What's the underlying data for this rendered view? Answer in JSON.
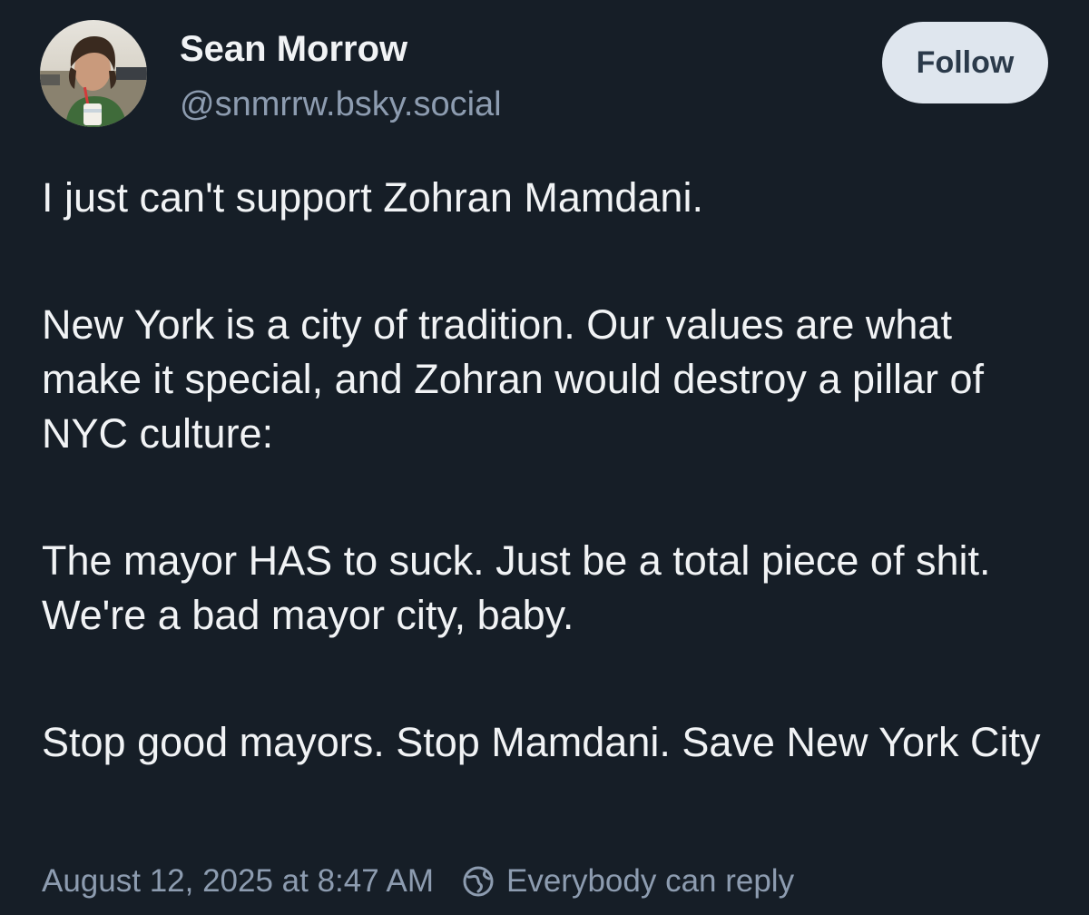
{
  "author": {
    "display_name": "Sean Morrow",
    "handle": "@snmrrw.bsky.social"
  },
  "follow_button": {
    "label": "Follow"
  },
  "post": {
    "paragraphs": [
      "I just can't support Zohran Mamdani.",
      "New York is a city of tradition. Our values are what make it special, and Zohran would destroy a pillar of NYC culture:",
      "The mayor HAS to suck. Just be a total piece of shit. We're a bad mayor city, baby.",
      "Stop good mayors. Stop Mamdani. Save New York City"
    ]
  },
  "meta": {
    "timestamp": "August 12, 2025 at 8:47 AM",
    "reply_setting_icon": "globe-icon",
    "reply_setting": "Everybody can reply"
  },
  "colors": {
    "background": "#161e27",
    "text_primary": "#f1f3f5",
    "text_secondary": "#8d9cb0",
    "follow_button_bg": "#dfe6ee",
    "follow_button_text": "#2b3a4a"
  }
}
